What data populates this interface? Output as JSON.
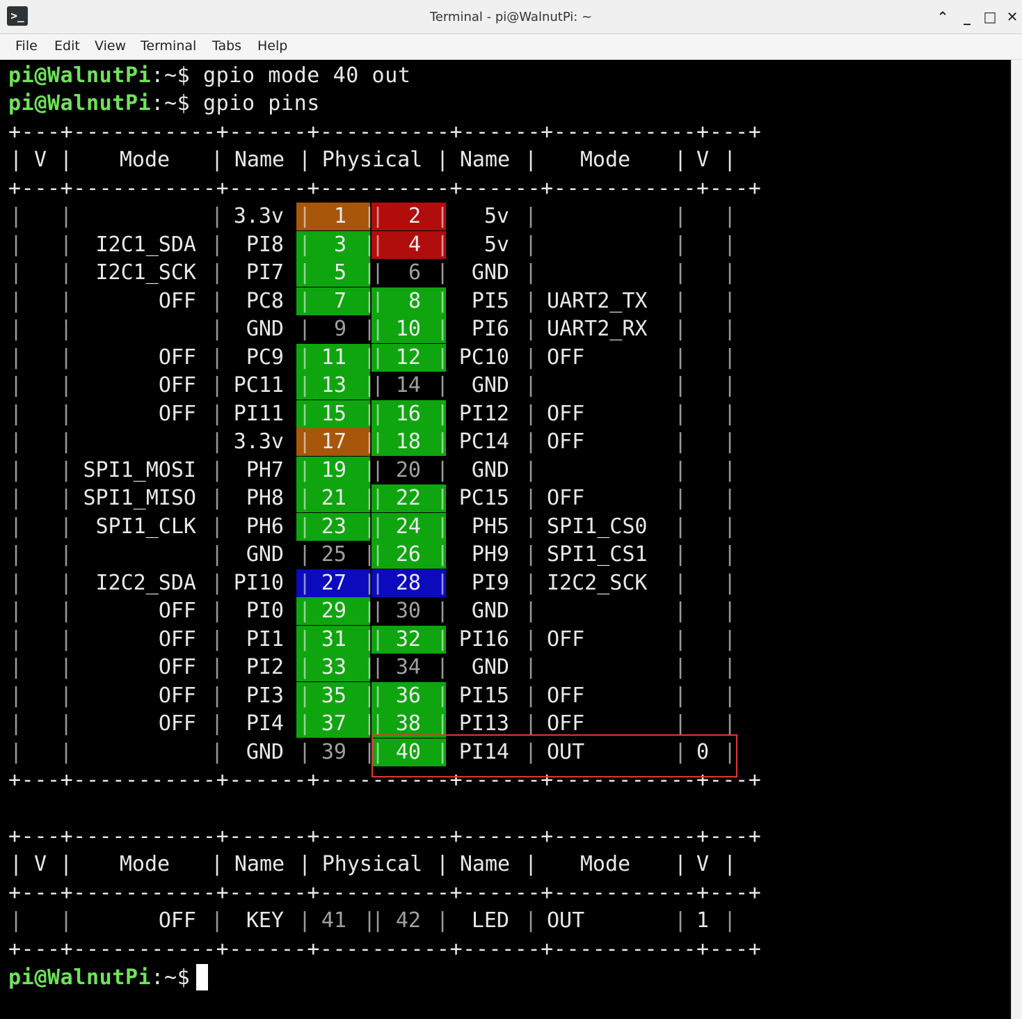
{
  "window": {
    "title": "Terminal - pi@WalnutPi: ~",
    "controls": [
      "⌃",
      "_",
      "□",
      "✕"
    ]
  },
  "menubar": [
    "File",
    "Edit",
    "View",
    "Terminal",
    "Tabs",
    "Help"
  ],
  "prompt": {
    "user_host": "pi@WalnutPi",
    "path": ":~",
    "dollar": "$"
  },
  "commands": [
    "gpio mode 40 out",
    "gpio pins"
  ],
  "table": {
    "border": "+---+-----------+------+----------+------+-----------+---+",
    "headers": [
      "V",
      "Mode",
      "Name",
      "Physical",
      "Name",
      "Mode",
      "V"
    ],
    "rows": [
      {
        "lv": "",
        "lmode": "",
        "lname": "3.3v",
        "lpin": "1",
        "rpin": "2",
        "rname": "5v",
        "rmode": "",
        "rv": "",
        "lbg": "#a8560a",
        "rbg": "#b20d0d"
      },
      {
        "lv": "",
        "lmode": "I2C1_SDA",
        "lname": "PI8",
        "lpin": "3",
        "rpin": "4",
        "rname": "5v",
        "rmode": "",
        "rv": "",
        "lbg": "#0fa50f",
        "rbg": "#b20d0d"
      },
      {
        "lv": "",
        "lmode": "I2C1_SCK",
        "lname": "PI7",
        "lpin": "5",
        "rpin": "6",
        "rname": "GND",
        "rmode": "",
        "rv": "",
        "lbg": "#0fa50f",
        "rbg": ""
      },
      {
        "lv": "",
        "lmode": "OFF",
        "lname": "PC8",
        "lpin": "7",
        "rpin": "8",
        "rname": "PI5",
        "rmode": "UART2_TX",
        "rv": "",
        "lbg": "#0fa50f",
        "rbg": "#0fa50f"
      },
      {
        "lv": "",
        "lmode": "",
        "lname": "GND",
        "lpin": "9",
        "rpin": "10",
        "rname": "PI6",
        "rmode": "UART2_RX",
        "rv": "",
        "lbg": "",
        "rbg": "#0fa50f"
      },
      {
        "lv": "",
        "lmode": "OFF",
        "lname": "PC9",
        "lpin": "11",
        "rpin": "12",
        "rname": "PC10",
        "rmode": "OFF",
        "rv": "",
        "lbg": "#0fa50f",
        "rbg": "#0fa50f"
      },
      {
        "lv": "",
        "lmode": "OFF",
        "lname": "PC11",
        "lpin": "13",
        "rpin": "14",
        "rname": "GND",
        "rmode": "",
        "rv": "",
        "lbg": "#0fa50f",
        "rbg": ""
      },
      {
        "lv": "",
        "lmode": "OFF",
        "lname": "PI11",
        "lpin": "15",
        "rpin": "16",
        "rname": "PI12",
        "rmode": "OFF",
        "rv": "",
        "lbg": "#0fa50f",
        "rbg": "#0fa50f"
      },
      {
        "lv": "",
        "lmode": "",
        "lname": "3.3v",
        "lpin": "17",
        "rpin": "18",
        "rname": "PC14",
        "rmode": "OFF",
        "rv": "",
        "lbg": "#a8560a",
        "rbg": "#0fa50f"
      },
      {
        "lv": "",
        "lmode": "SPI1_MOSI",
        "lname": "PH7",
        "lpin": "19",
        "rpin": "20",
        "rname": "GND",
        "rmode": "",
        "rv": "",
        "lbg": "#0fa50f",
        "rbg": ""
      },
      {
        "lv": "",
        "lmode": "SPI1_MISO",
        "lname": "PH8",
        "lpin": "21",
        "rpin": "22",
        "rname": "PC15",
        "rmode": "OFF",
        "rv": "",
        "lbg": "#0fa50f",
        "rbg": "#0fa50f"
      },
      {
        "lv": "",
        "lmode": "SPI1_CLK",
        "lname": "PH6",
        "lpin": "23",
        "rpin": "24",
        "rname": "PH5",
        "rmode": "SPI1_CS0",
        "rv": "",
        "lbg": "#0fa50f",
        "rbg": "#0fa50f"
      },
      {
        "lv": "",
        "lmode": "",
        "lname": "GND",
        "lpin": "25",
        "rpin": "26",
        "rname": "PH9",
        "rmode": "SPI1_CS1",
        "rv": "",
        "lbg": "",
        "rbg": "#0fa50f"
      },
      {
        "lv": "",
        "lmode": "I2C2_SDA",
        "lname": "PI10",
        "lpin": "27",
        "rpin": "28",
        "rname": "PI9",
        "rmode": "I2C2_SCK",
        "rv": "",
        "lbg": "#0b0bbd",
        "rbg": "#0b0bbd"
      },
      {
        "lv": "",
        "lmode": "OFF",
        "lname": "PI0",
        "lpin": "29",
        "rpin": "30",
        "rname": "GND",
        "rmode": "",
        "rv": "",
        "lbg": "#0fa50f",
        "rbg": ""
      },
      {
        "lv": "",
        "lmode": "OFF",
        "lname": "PI1",
        "lpin": "31",
        "rpin": "32",
        "rname": "PI16",
        "rmode": "OFF",
        "rv": "",
        "lbg": "#0fa50f",
        "rbg": "#0fa50f"
      },
      {
        "lv": "",
        "lmode": "OFF",
        "lname": "PI2",
        "lpin": "33",
        "rpin": "34",
        "rname": "GND",
        "rmode": "",
        "rv": "",
        "lbg": "#0fa50f",
        "rbg": ""
      },
      {
        "lv": "",
        "lmode": "OFF",
        "lname": "PI3",
        "lpin": "35",
        "rpin": "36",
        "rname": "PI15",
        "rmode": "OFF",
        "rv": "",
        "lbg": "#0fa50f",
        "rbg": "#0fa50f"
      },
      {
        "lv": "",
        "lmode": "OFF",
        "lname": "PI4",
        "lpin": "37",
        "rpin": "38",
        "rname": "PI13",
        "rmode": "OFF",
        "rv": "",
        "lbg": "#0fa50f",
        "rbg": "#0fa50f"
      },
      {
        "lv": "",
        "lmode": "",
        "lname": "GND",
        "lpin": "39",
        "rpin": "40",
        "rname": "PI14",
        "rmode": "OUT",
        "rv": "0",
        "lbg": "",
        "rbg": "#0fa50f"
      }
    ]
  },
  "table2": {
    "rows": [
      {
        "lv": "",
        "lmode": "OFF",
        "lname": "KEY",
        "lpin": "41",
        "rpin": "42",
        "rname": "LED",
        "rmode": "OUT",
        "rv": "1",
        "lbg": "",
        "rbg": ""
      }
    ]
  },
  "colors": {
    "prompt_user": "#6fe35a",
    "prompt_path": "#6f8fd8",
    "pwr_3v3": "#a8560a",
    "pwr_5v": "#b20d0d",
    "gpio": "#0fa50f",
    "i2c2": "#0b0bbd",
    "highlight_box": "#e03a2e"
  }
}
